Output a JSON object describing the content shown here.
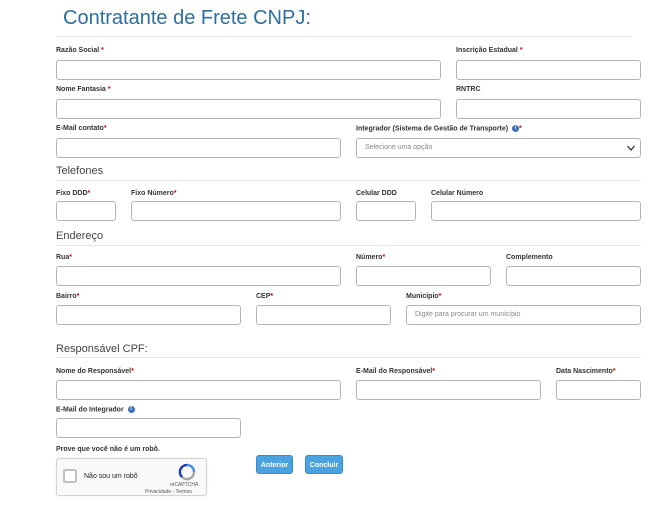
{
  "page": {
    "title": "Contratante de Frete CNPJ:"
  },
  "fields": {
    "razao_social": {
      "label": "Razão Social",
      "required": "*",
      "value": ""
    },
    "inscricao_estadual": {
      "label": "Inscrição Estadual",
      "required": "*",
      "value": ""
    },
    "nome_fantasia": {
      "label": "Nome Fantasia",
      "required": "*",
      "value": ""
    },
    "rntrc": {
      "label": "RNTRC",
      "value": ""
    },
    "email_contato": {
      "label": "E-Mail contato",
      "required": "*",
      "value": ""
    },
    "integrador": {
      "label": "Integrador (Sistema de Gestão de Transporte)",
      "required": "*",
      "selected": "Selecione uma opção"
    }
  },
  "telefones": {
    "heading": "Telefones",
    "fixo_ddd": {
      "label": "Fixo DDD",
      "required": "*"
    },
    "fixo_numero": {
      "label": "Fixo Número",
      "required": "*"
    },
    "celular_ddd": {
      "label": "Celular DDD"
    },
    "celular_numero": {
      "label": "Celular Número"
    }
  },
  "endereco": {
    "heading": "Endereço",
    "rua": {
      "label": "Rua",
      "required": "*"
    },
    "numero": {
      "label": "Número",
      "required": "*"
    },
    "complemento": {
      "label": "Complemento"
    },
    "bairro": {
      "label": "Bairro",
      "required": "*"
    },
    "cep": {
      "label": "CEP",
      "required": "*"
    },
    "municipio": {
      "label": "Município",
      "required": "*",
      "placeholder": "Digite para procurar um município"
    }
  },
  "responsavel": {
    "heading": "Responsável CPF:",
    "nome": {
      "label": "Nome do Responsável",
      "required": "*"
    },
    "email": {
      "label": "E-Mail do Responsável",
      "required": "*"
    },
    "nascimento": {
      "label": "Data Nascimento",
      "required": "*"
    },
    "email_integrador": {
      "label": "E-Mail do Integrador"
    }
  },
  "captcha": {
    "prompt": "Prove que você não é um robô.",
    "checkbox_label": "Não sou um robô",
    "brand": "reCAPTCHA",
    "links": "Privacidade - Termos"
  },
  "buttons": {
    "anterior": "Anterior",
    "concluir": "Concluir"
  },
  "icons": {
    "info": "info-icon",
    "chevron": "chevron-down-icon",
    "recaptcha": "recaptcha-logo-icon"
  },
  "colors": {
    "title": "#2e6f9e",
    "required": "#cc0000",
    "button": "#4aa3e0",
    "info": "#3a72b8"
  }
}
